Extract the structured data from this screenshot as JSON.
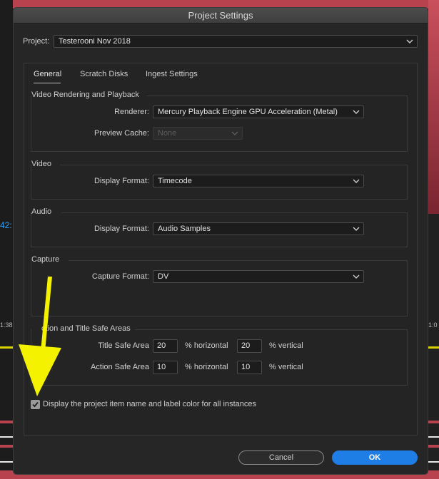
{
  "background": {
    "timecode_fragment": "42:",
    "left_time": "1:38",
    "right_time": "1:0"
  },
  "dialog": {
    "title": "Project Settings",
    "project_label": "Project:",
    "project_value": "Testerooni Nov 2018",
    "tabs": [
      {
        "label": "General",
        "active": true
      },
      {
        "label": "Scratch Disks",
        "active": false
      },
      {
        "label": "Ingest Settings",
        "active": false
      }
    ],
    "video_rendering": {
      "title": "Video Rendering and Playback",
      "renderer_label": "Renderer:",
      "renderer_value": "Mercury Playback Engine GPU Acceleration (Metal)",
      "preview_cache_label": "Preview Cache:",
      "preview_cache_value": "None"
    },
    "video": {
      "title": "Video",
      "display_format_label": "Display Format:",
      "display_format_value": "Timecode"
    },
    "audio": {
      "title": "Audio",
      "display_format_label": "Display Format:",
      "display_format_value": "Audio Samples"
    },
    "capture": {
      "title": "Capture",
      "capture_format_label": "Capture Format:",
      "capture_format_value": "DV"
    },
    "safe_areas": {
      "title": "Action and Title Safe Areas",
      "visible_title": "ction and Title Safe Areas",
      "title_safe_label": "Title Safe Area",
      "title_safe_h": "20",
      "title_safe_v": "20",
      "action_safe_label": "Action Safe Area",
      "action_safe_h": "10",
      "action_safe_v": "10",
      "h_unit": "% horizontal",
      "v_unit": "% vertical"
    },
    "display_item_checkbox": {
      "label": "Display the project item name and label color for all instances",
      "checked": true
    },
    "cancel_label": "Cancel",
    "ok_label": "OK"
  },
  "colors": {
    "accent": "#1f7ee6",
    "arrow": "#f5f200",
    "background_red": "#b8434f"
  }
}
